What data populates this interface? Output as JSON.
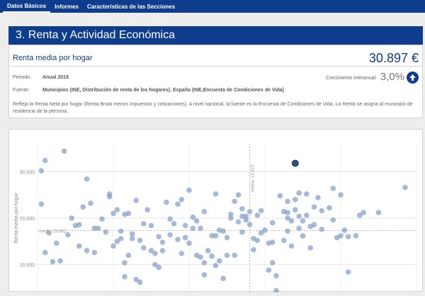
{
  "nav": {
    "tabs": [
      {
        "label": "Datos Básicos",
        "active": true
      },
      {
        "label": "Informes",
        "active": false
      },
      {
        "label": "Características de las Secciones",
        "active": false
      }
    ]
  },
  "section": {
    "title": "3. Renta y Actividad Económica"
  },
  "card": {
    "title": "Renta media por hogar",
    "value": "30.897 €",
    "periodo_label": "Periodo:",
    "periodo_value": "Anual 2018",
    "fuente_label": "Fuente:",
    "fuente_value": "Municipios (INE, Distribución de renta de los hogares). España (INE,Encuesta de Condiciones de Vida)",
    "growth_label": "Crecimiento interanual:",
    "growth_value": "3,0%",
    "growth_icon": "arrow-up-icon",
    "description": "Refleja la Renta Neta por hogar (Renta Bruta menos impuestos y cotizaciones). A nivel nacional, la fuente es la Encuesta de Condiciones de Vida. La Renta se asigna al municipio de residencia de la persona."
  },
  "colors": {
    "brand": "#0d3d8c",
    "point": "#7f9dc8",
    "highlight": "#2f4f8a"
  },
  "chart_data": {
    "type": "scatter",
    "ylabel": "Renta media por hogar",
    "yticks": [
      "30.000",
      "25.000",
      "20.000"
    ],
    "ylim": [
      17000,
      33000
    ],
    "xlim": [
      0,
      100
    ],
    "median_x_label": "media: 13.323",
    "median_x": 56,
    "median_y_label": "media: 23.662",
    "median_y": 23662,
    "highlight": {
      "x": 68,
      "y": 30900
    },
    "points": [
      [
        1,
        30100
      ],
      [
        2,
        31200
      ],
      [
        3,
        23400
      ],
      [
        1,
        26500
      ],
      [
        4,
        20300
      ],
      [
        6,
        20400
      ],
      [
        2,
        21300
      ],
      [
        7,
        32200
      ],
      [
        9,
        25000
      ],
      [
        11,
        24300
      ],
      [
        12,
        26200
      ],
      [
        13,
        29200
      ],
      [
        11,
        22000
      ],
      [
        15,
        23900
      ],
      [
        16,
        23900
      ],
      [
        14,
        26600
      ],
      [
        18,
        23500
      ],
      [
        19,
        27600
      ],
      [
        19,
        27300
      ],
      [
        20,
        25500
      ],
      [
        21,
        25900
      ],
      [
        22,
        23600
      ],
      [
        22,
        22800
      ],
      [
        23,
        25400
      ],
      [
        24,
        25500
      ],
      [
        25,
        23300
      ],
      [
        26,
        26900
      ],
      [
        25,
        22800
      ],
      [
        24,
        21000
      ],
      [
        23,
        20200
      ],
      [
        23,
        18700
      ],
      [
        26,
        18400
      ],
      [
        27,
        18100
      ],
      [
        27,
        22600
      ],
      [
        28,
        21800
      ],
      [
        29,
        25900
      ],
      [
        30,
        21500
      ],
      [
        31,
        21200
      ],
      [
        31,
        20000
      ],
      [
        32,
        23000
      ],
      [
        33,
        21500
      ],
      [
        32,
        19700
      ],
      [
        34,
        26700
      ],
      [
        35,
        23200
      ],
      [
        36,
        24400
      ],
      [
        37,
        22700
      ],
      [
        37,
        26500
      ],
      [
        38,
        27000
      ],
      [
        38,
        21200
      ],
      [
        39,
        22900
      ],
      [
        40,
        22300
      ],
      [
        40,
        28000
      ],
      [
        41,
        25100
      ],
      [
        41,
        23900
      ],
      [
        42,
        24700
      ],
      [
        42,
        21000
      ],
      [
        43,
        20800
      ],
      [
        44,
        25700
      ],
      [
        44,
        18900
      ],
      [
        45,
        21500
      ],
      [
        46,
        23100
      ],
      [
        47,
        27600
      ],
      [
        47,
        19900
      ],
      [
        48,
        20400
      ],
      [
        49,
        23600
      ],
      [
        49,
        18500
      ],
      [
        50,
        22900
      ],
      [
        51,
        25000
      ],
      [
        52,
        21000
      ],
      [
        53,
        24600
      ],
      [
        53,
        27500
      ],
      [
        54,
        25200
      ],
      [
        54,
        26000
      ],
      [
        54,
        23500
      ],
      [
        55,
        25200
      ],
      [
        55,
        24800
      ],
      [
        56,
        25700
      ],
      [
        56,
        24300
      ],
      [
        57,
        22800
      ],
      [
        57,
        21600
      ],
      [
        58,
        22600
      ],
      [
        58,
        25300
      ],
      [
        59,
        23400
      ],
      [
        60,
        23700
      ],
      [
        61,
        19400
      ],
      [
        62,
        20200
      ],
      [
        62,
        22400
      ],
      [
        62,
        24500
      ],
      [
        63,
        18800
      ],
      [
        63,
        17200
      ],
      [
        64,
        27400
      ],
      [
        65,
        25700
      ],
      [
        65,
        22600
      ],
      [
        66,
        23600
      ],
      [
        66,
        26800
      ],
      [
        67,
        24700
      ],
      [
        67,
        22000
      ],
      [
        68,
        27000
      ],
      [
        68,
        25900
      ],
      [
        68,
        30900
      ],
      [
        69,
        27700
      ],
      [
        69,
        23900
      ],
      [
        70,
        24700
      ],
      [
        70,
        23100
      ],
      [
        71,
        25300
      ],
      [
        72,
        21800
      ],
      [
        72,
        24100
      ],
      [
        73,
        26200
      ],
      [
        73,
        24300
      ],
      [
        74,
        27200
      ],
      [
        75,
        25800
      ],
      [
        75,
        23800
      ],
      [
        77,
        26100
      ],
      [
        78,
        24800
      ],
      [
        79,
        22900
      ],
      [
        80,
        23100
      ],
      [
        81,
        23700
      ],
      [
        82,
        19200
      ],
      [
        84,
        23100
      ],
      [
        85,
        25300
      ],
      [
        86,
        25600
      ],
      [
        90,
        25600
      ],
      [
        80,
        27500
      ],
      [
        48,
        23700
      ],
      [
        47,
        23100
      ],
      [
        50,
        21000
      ],
      [
        51,
        25400
      ],
      [
        52,
        26800
      ],
      [
        66,
        25600
      ],
      [
        69,
        25200
      ],
      [
        15,
        21300
      ],
      [
        20,
        22000
      ],
      [
        17,
        24900
      ],
      [
        30,
        24200
      ],
      [
        35,
        24900
      ],
      [
        43,
        23900
      ],
      [
        8,
        23200
      ],
      [
        10,
        24200
      ],
      [
        13,
        21500
      ],
      [
        5,
        22300
      ],
      [
        21,
        22500
      ],
      [
        28,
        24400
      ],
      [
        33,
        22400
      ],
      [
        46,
        20900
      ],
      [
        44,
        20200
      ],
      [
        39,
        24200
      ],
      [
        71,
        27600
      ],
      [
        78,
        28200
      ],
      [
        66,
        25000
      ],
      [
        59,
        25800
      ],
      [
        61,
        22300
      ],
      [
        97,
        28300
      ],
      [
        82,
        23000
      ]
    ]
  }
}
